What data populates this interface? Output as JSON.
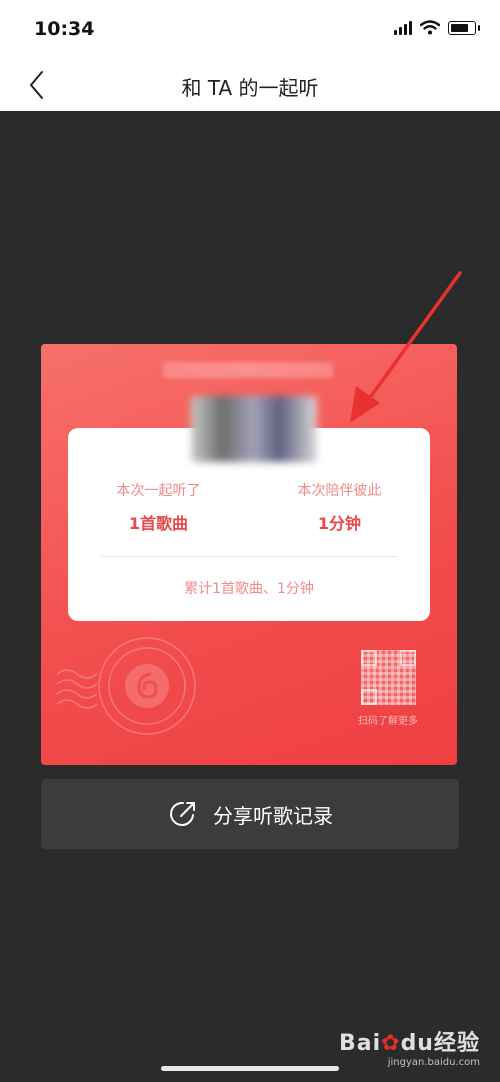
{
  "status_bar": {
    "time": "10:34",
    "battery_level": 0.8
  },
  "nav": {
    "title": "和 TA 的一起听"
  },
  "card": {
    "left_stat": {
      "label": "本次一起听了",
      "value": "1首歌曲"
    },
    "right_stat": {
      "label": "本次陪伴彼此",
      "value": "1分钟"
    },
    "total": "累计1首歌曲、1分钟",
    "qr_label": "扫码了解更多"
  },
  "share_button": {
    "label": "分享听歌记录"
  },
  "watermark": {
    "logo_left": "Bai",
    "logo_mid": "du",
    "logo_right": "经验",
    "url": "jingyan.baidu.com"
  },
  "colors": {
    "card_accent": "#f24c4c",
    "arrow": "#e8322f",
    "button_bg": "#3c3c3c"
  }
}
